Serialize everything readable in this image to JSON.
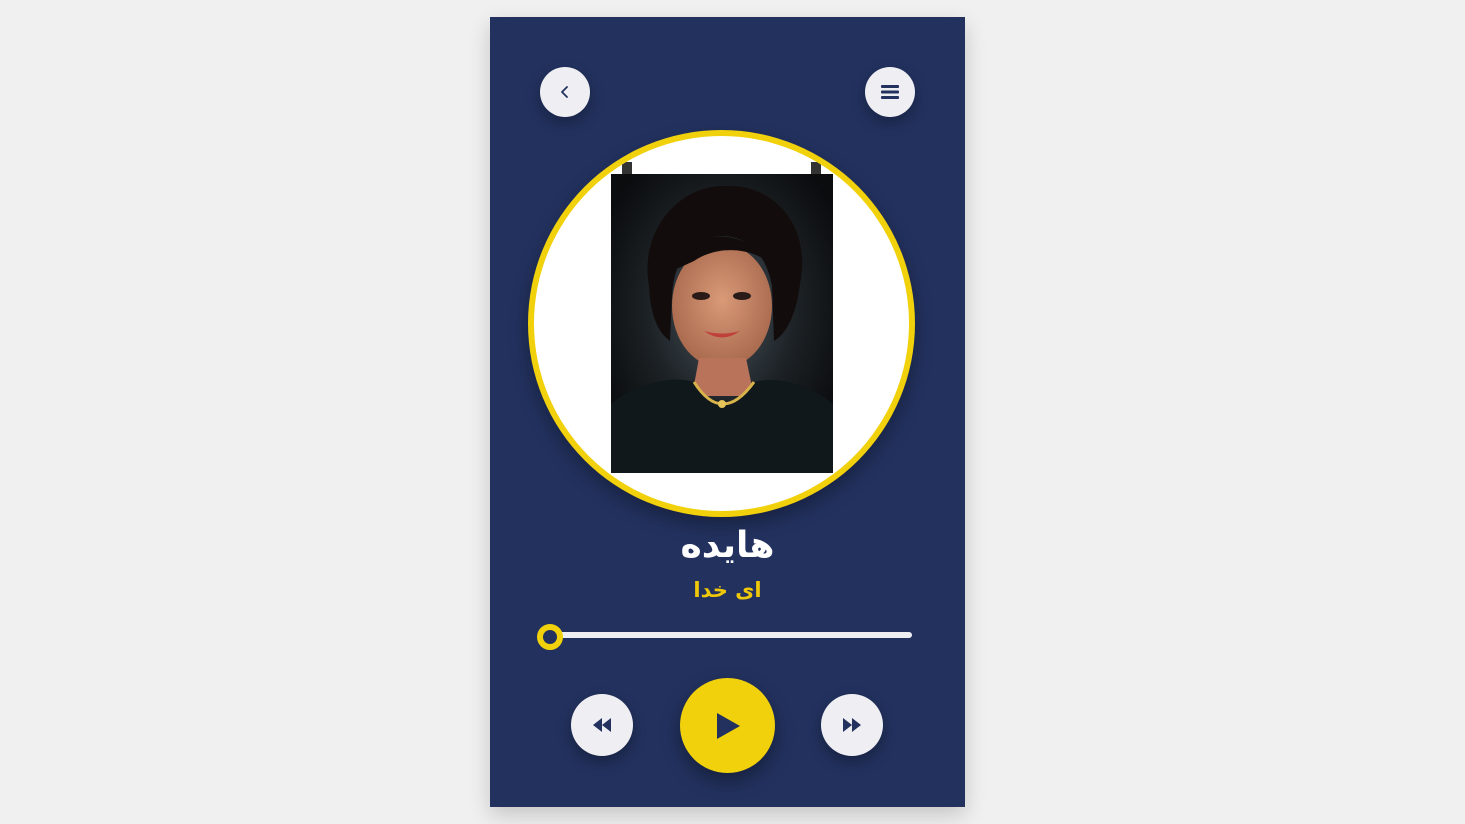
{
  "player": {
    "artist_name": "هایده",
    "song_title": "ای خدا",
    "progress": 0,
    "icons": {
      "back": "chevron-left-icon",
      "menu": "hamburger-menu-icon",
      "previous": "backward-icon",
      "play": "play-icon",
      "next": "forward-icon"
    }
  },
  "colors": {
    "background": "#f0f0f0",
    "card": "#22315e",
    "accent": "#f0d10c",
    "button": "#efeff3",
    "text_primary": "#ffffff",
    "text_secondary": "#f0c80a"
  }
}
